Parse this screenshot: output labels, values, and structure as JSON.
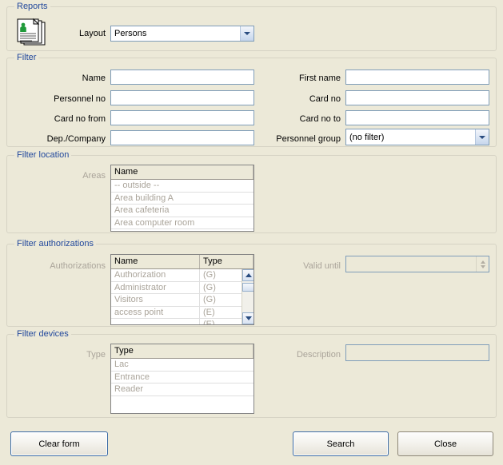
{
  "reports": {
    "legend": "Reports",
    "icon": "documents-person-icon",
    "layout_label": "Layout",
    "layout_value": "Persons"
  },
  "filter": {
    "legend": "Filter",
    "fields": {
      "name_label": "Name",
      "name_value": "",
      "first_name_label": "First name",
      "first_name_value": "",
      "personnel_no_label": "Personnel no",
      "personnel_no_value": "",
      "card_no_label": "Card no",
      "card_no_value": "",
      "card_no_from_label": "Card no from",
      "card_no_from_value": "",
      "card_no_to_label": "Card no to",
      "card_no_to_value": "",
      "dep_company_label": "Dep./Company",
      "dep_company_value": "",
      "personnel_group_label": "Personnel group",
      "personnel_group_value": "(no filter)"
    }
  },
  "filter_location": {
    "legend": "Filter location",
    "areas_label": "Areas",
    "columns": [
      "Name"
    ],
    "rows": [
      [
        "-- outside --"
      ],
      [
        "Area building A"
      ],
      [
        "Area cafeteria"
      ],
      [
        "Area computer room"
      ],
      [
        ""
      ]
    ]
  },
  "filter_authorizations": {
    "legend": "Filter authorizations",
    "authorizations_label": "Authorizations",
    "columns": [
      "Name",
      "Type"
    ],
    "rows": [
      [
        "Authorization",
        "(G)"
      ],
      [
        "Administrator",
        "(G)"
      ],
      [
        "Visitors",
        "(G)"
      ],
      [
        "access point",
        "(E)"
      ],
      [
        "",
        "(E)"
      ]
    ],
    "valid_until_label": "Valid until",
    "valid_until_value": ""
  },
  "filter_devices": {
    "legend": "Filter devices",
    "type_label": "Type",
    "columns": [
      "Type"
    ],
    "rows": [
      [
        "Lac"
      ],
      [
        "Entrance"
      ],
      [
        "Reader"
      ],
      [
        ""
      ],
      [
        ""
      ]
    ],
    "description_label": "Description",
    "description_value": ""
  },
  "buttons": {
    "clear_form": "Clear form",
    "search": "Search",
    "close": "Close"
  },
  "colors": {
    "window_bg": "#ece9d8",
    "legend_blue": "#21489c",
    "disabled_text": "#aaa49a",
    "input_border": "#7f9db9",
    "focus_border": "#3c6ba5"
  }
}
